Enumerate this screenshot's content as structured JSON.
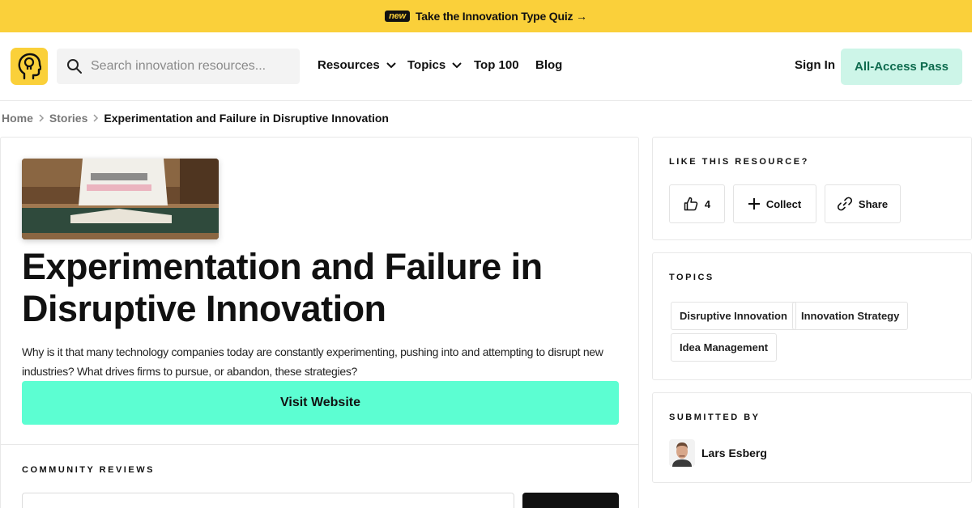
{
  "banner": {
    "badge": "new",
    "text": "Take the Innovation Type Quiz →"
  },
  "header": {
    "logo_icon": "head-lightbulb-icon",
    "search_placeholder": "Search innovation resources...",
    "nav": [
      {
        "label": "Resources",
        "has_dropdown": true
      },
      {
        "label": "Topics",
        "has_dropdown": true
      },
      {
        "label": "Top 100",
        "has_dropdown": false
      },
      {
        "label": "Blog",
        "has_dropdown": false
      }
    ],
    "sign_in": "Sign In",
    "cta": "All-Access Pass"
  },
  "breadcrumb": {
    "home": "Home",
    "section": "Stories",
    "current": "Experimentation and Failure in Disruptive Innovation"
  },
  "article": {
    "title": "Experimentation and Failure in Disruptive Innovation",
    "description": "Why is it that many technology companies today are constantly experimenting, pushing into and attempting to disrupt new industries? What drives firms to pursue, or abandon, these strategies?",
    "visit_button": "Visit Website",
    "reviews_label": "COMMUNITY REVIEWS"
  },
  "sidebar": {
    "like": {
      "label": "LIKE THIS RESOURCE?",
      "likes": "4",
      "collect": "Collect",
      "share": "Share"
    },
    "topics": {
      "label": "TOPICS",
      "tags": [
        "Disruptive Innovation",
        "Innovation Strategy",
        "Idea Management"
      ]
    },
    "submitted": {
      "label": "SUBMITTED BY",
      "name": "Lars Esberg"
    }
  },
  "colors": {
    "banner": "#fad03a",
    "accent_green": "#5cfed2",
    "pass_bg": "#cdf5e8"
  }
}
